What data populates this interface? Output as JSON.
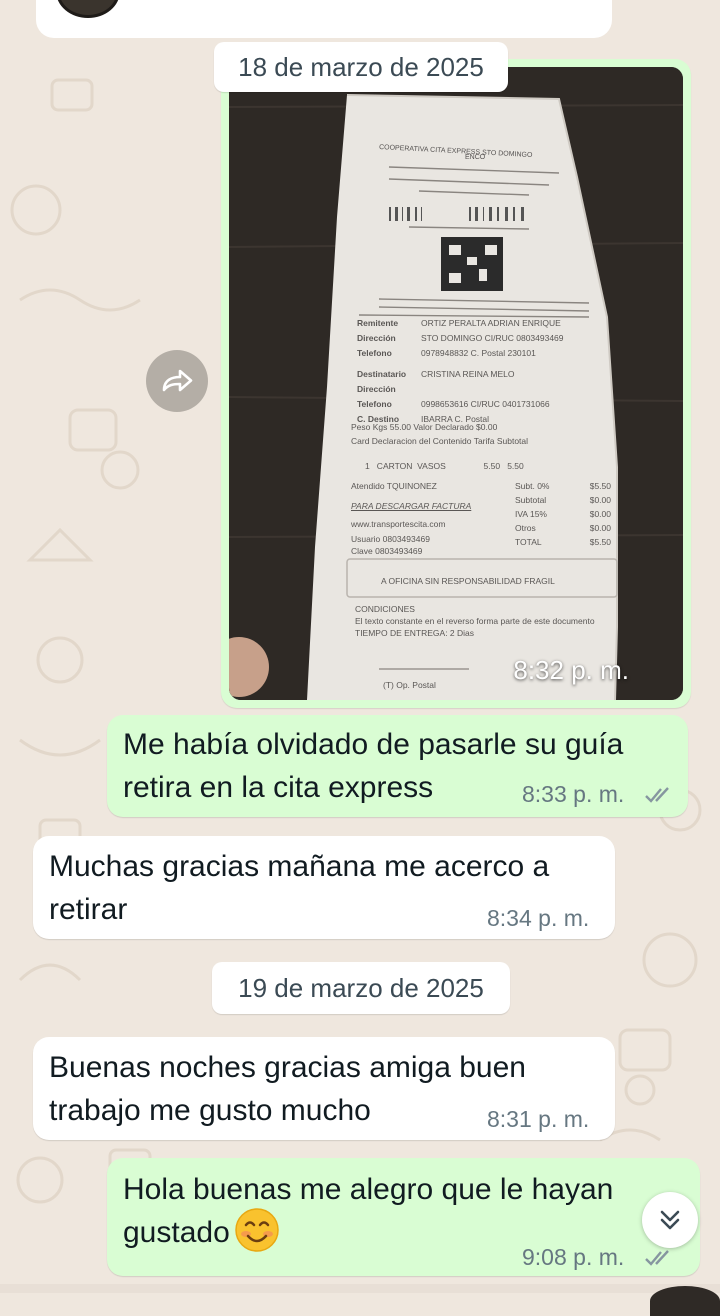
{
  "chat": {
    "date_1": "18 de marzo de 2025",
    "date_2": "19 de marzo de 2025",
    "messages": [
      {
        "type": "image",
        "direction": "outgoing",
        "image": "photo of a shipping receipt (COOPERATIVA CITA EXPRESS)",
        "time": "8:32 p. m."
      },
      {
        "type": "text",
        "direction": "outgoing",
        "text": "Me había olvidado de pasarle su guía\nretira en la cita express",
        "time": "8:33 p. m.",
        "status": "read"
      },
      {
        "type": "text",
        "direction": "incoming",
        "text": "Muchas gracias mañana me acerco a\nretirar",
        "time": "8:34 p. m."
      },
      {
        "type": "text",
        "direction": "incoming",
        "text": "Buenas noches gracias amiga  buen\ntrabajo me gusto mucho",
        "time": "8:31 p. m."
      },
      {
        "type": "text",
        "direction": "outgoing",
        "text": "Hola buenas me alegro que le hayan\ngustado",
        "emoji": "smiling-face-emoji",
        "time": "9:08 p. m.",
        "status": "read"
      }
    ]
  },
  "receipt": {
    "company": "COOPERATIVA CITA EXPRESS STO DOMINGO",
    "company_sub": "ENCO",
    "rows": [
      {
        "label": "Remitente",
        "value": "ORTIZ PERALTA ADRIAN ENRIQUE"
      },
      {
        "label": "Dirección",
        "value": "STO DOMINGO   CI/RUC 0803493469"
      },
      {
        "label": "Telefono",
        "value": "0978948832    C. Postal 230101"
      },
      {
        "label": "Destinatario",
        "value": "CRISTINA REINA MELO"
      },
      {
        "label": "Dirección",
        "value": ""
      },
      {
        "label": "Telefono",
        "value": "0998653616     CI/RUC 0401731066"
      },
      {
        "label": "C. Destino",
        "value": "IBARRA        C. Postal"
      }
    ],
    "peso": "Peso Kgs   55.00        Valor Declarado   $0.00",
    "header_cols": "Card   Declaracion del Contenido      Tarifa  Subtotal",
    "item": "1   CARTON  VASOS                5.50   5.50",
    "atendido": "Atendido   TQUINONEZ",
    "descargar": "PARA DESCARGAR FACTURA",
    "web": "www.transportescita.com",
    "usuario": "Usuario   0803493469",
    "clave": "Clave     0803493469",
    "totals": [
      {
        "label": "Subt. 0%",
        "value": "$5.50"
      },
      {
        "label": "Subtotal",
        "value": "$0.00"
      },
      {
        "label": "IVA 15%",
        "value": "$0.00"
      },
      {
        "label": "Otros",
        "value": "$0.00"
      },
      {
        "label": "TOTAL",
        "value": "$5.50"
      }
    ],
    "notice": "A OFICINA SIN RESPONSABILIDAD FRAGIL",
    "conditions_title": "CONDICIONES",
    "conditions_text": "El texto constante en el reverso forma parte de este documento  TIEMPO DE ENTREGA: 2 Dias",
    "footer": "(T) Op. Postal"
  },
  "colors": {
    "background": "#efe7de",
    "outgoing_bubble": "#d9fdd3",
    "incoming_bubble": "#ffffff",
    "timestamp": "#667781",
    "read_ticks": "#8696a0"
  },
  "icons": {
    "forward": "forward-arrow-icon",
    "scroll_down": "double-chevron-down-icon",
    "read_status": "double-check-icon"
  }
}
